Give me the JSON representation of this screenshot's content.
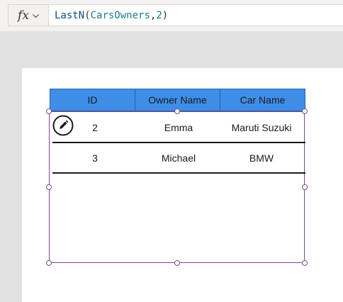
{
  "formula_bar": {
    "fx_label": "fx",
    "formula": {
      "function": "LastN",
      "open_paren": "(",
      "argument": "CarsOwners",
      "separator": ",",
      "count": "2",
      "close_paren": ")"
    }
  },
  "table": {
    "header_color": "#3e8ee8",
    "columns": [
      "ID",
      "Owner Name",
      "Car Name"
    ],
    "rows": [
      {
        "id": "2",
        "owner": "Emma",
        "car": "Maruti Suzuki"
      },
      {
        "id": "3",
        "owner": "Michael",
        "car": "BMW"
      }
    ]
  },
  "icons": {
    "formula_dropdown": "chevron-down-icon",
    "edit": "pencil-icon"
  }
}
